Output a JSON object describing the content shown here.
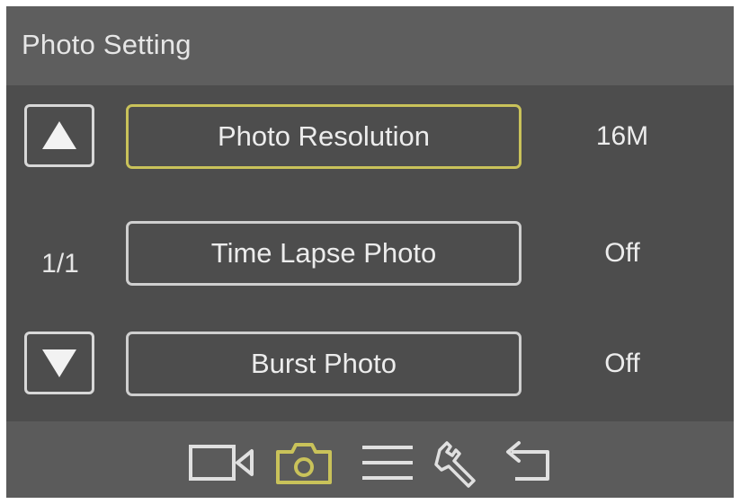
{
  "header": {
    "title": "Photo Setting"
  },
  "pager": {
    "indicator": "1/1",
    "up_icon": "arrow-up-icon",
    "down_icon": "arrow-down-icon"
  },
  "menu": {
    "items": [
      {
        "label": "Photo Resolution",
        "value": "16M",
        "selected": true
      },
      {
        "label": "Time Lapse Photo",
        "value": "Off",
        "selected": false
      },
      {
        "label": "Burst Photo",
        "value": "Off",
        "selected": false
      }
    ]
  },
  "footer": {
    "tabs": [
      {
        "icon": "video-camera-icon",
        "active": false
      },
      {
        "icon": "photo-camera-icon",
        "active": true
      },
      {
        "icon": "menu-icon",
        "active": false
      },
      {
        "icon": "wrench-icon",
        "active": false
      },
      {
        "icon": "back-arrow-icon",
        "active": false
      }
    ]
  },
  "colors": {
    "selected_border": "#c9c25a",
    "active_tab": "#c9c25a",
    "inactive_icon": "#e0e0e0",
    "background": "#4d4d4d",
    "header_bg": "#5e5e5e"
  }
}
